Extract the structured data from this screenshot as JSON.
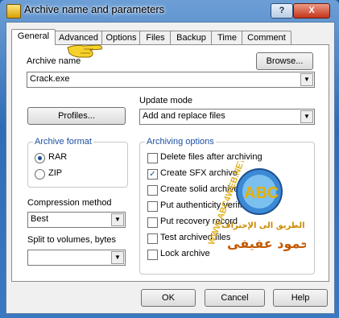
{
  "window": {
    "title": "Archive name and parameters",
    "help_label": "?",
    "close_label": "X"
  },
  "tabs": [
    "General",
    "Advanced",
    "Options",
    "Files",
    "Backup",
    "Time",
    "Comment"
  ],
  "archive_name": {
    "label": "Archive name",
    "value": "Crack.exe",
    "browse_label": "Browse..."
  },
  "profiles_label": "Profiles...",
  "update_mode": {
    "label": "Update mode",
    "value": "Add and replace files"
  },
  "archive_format": {
    "title": "Archive format",
    "options": [
      "RAR",
      "ZIP"
    ],
    "selected": "RAR"
  },
  "compression": {
    "label": "Compression method",
    "value": "Best"
  },
  "split": {
    "label": "Split to volumes, bytes",
    "value": ""
  },
  "archiving_options": {
    "title": "Archiving options",
    "items": [
      {
        "label": "Delete files after archiving",
        "checked": false
      },
      {
        "label": "Create SFX archive",
        "checked": true
      },
      {
        "label": "Create solid archive",
        "checked": false
      },
      {
        "label": "Put authenticity verification",
        "checked": false
      },
      {
        "label": "Put recovery record",
        "checked": false
      },
      {
        "label": "Test archived files",
        "checked": false
      },
      {
        "label": "Lock archive",
        "checked": false
      }
    ]
  },
  "buttons": {
    "ok": "OK",
    "cancel": "Cancel",
    "help": "Help"
  },
  "watermark": {
    "site": "WWW.ABC4WEB.NET",
    "logo": "ABC",
    "tagline": "الطريق الى الإحتراف",
    "author": "محمود عفيفى"
  }
}
